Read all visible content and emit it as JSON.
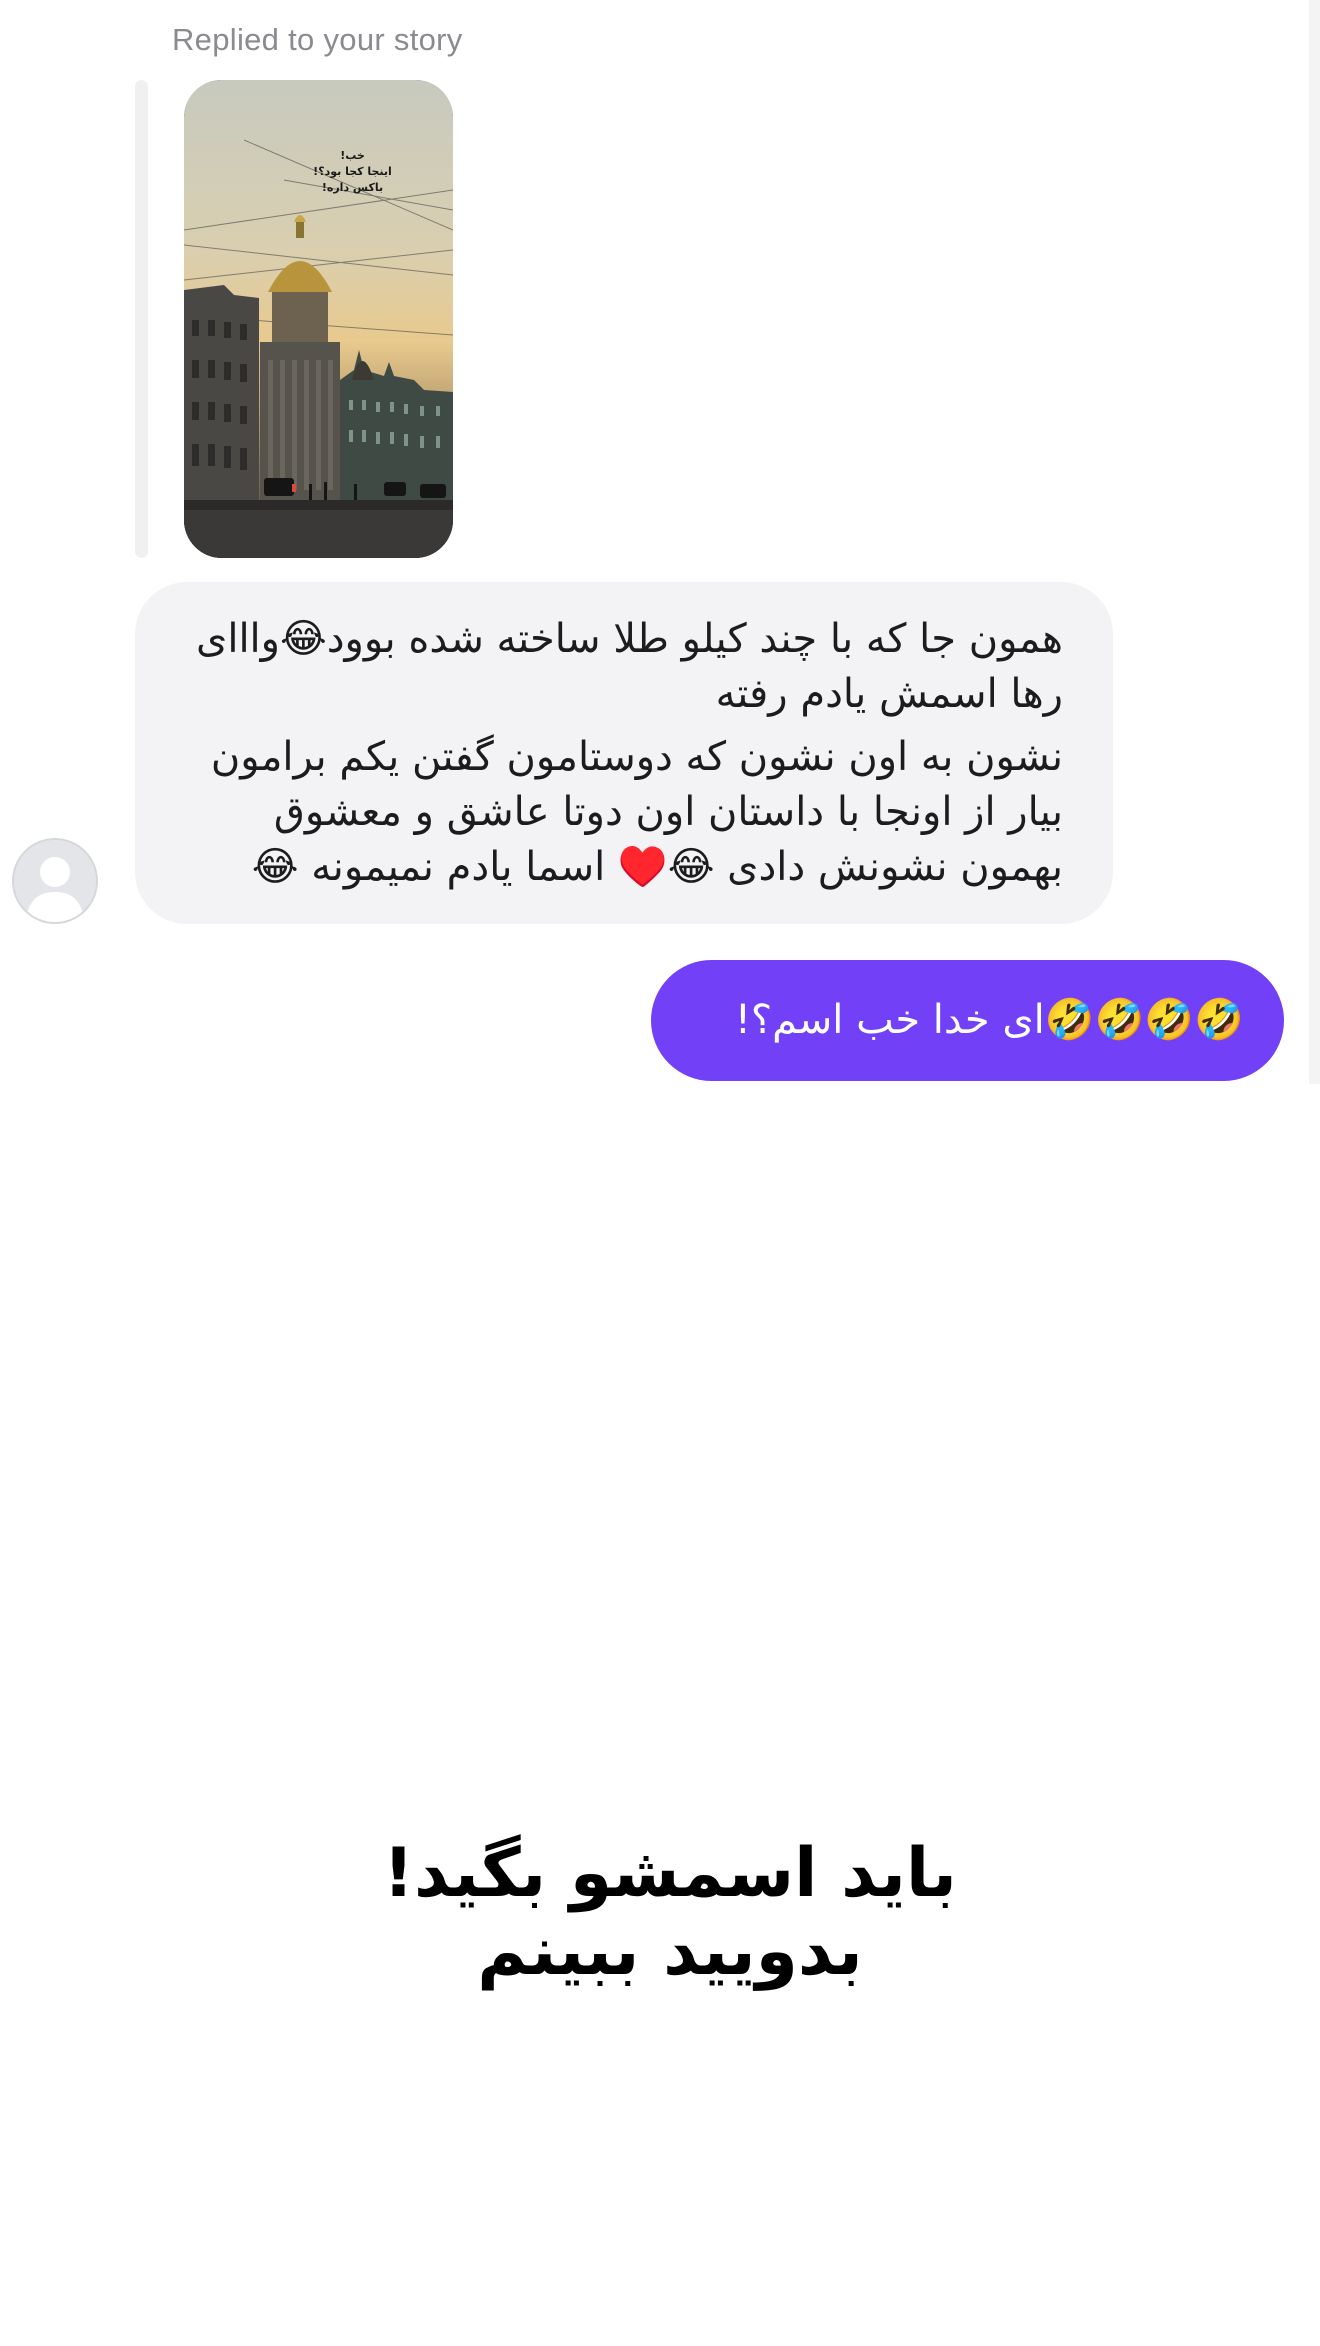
{
  "story_reply": {
    "label": "Replied to your story",
    "story_text": [
      "خب!",
      "اینجا کجا بود؟!",
      "باکس داره!"
    ]
  },
  "incoming_message": {
    "paragraphs": [
      "همون جا که با چند کیلو طلا ساخته شده بوود😂وااای رها اسمش یادم رفته",
      "نشون به اون نشون که دوستامون گفتن یکم برامون بیار از اونجا با داستان اون دوتا عاشق و معشوق بهمون نشونش دادی 😂♥️ اسما یادم نمیمونه 😂"
    ]
  },
  "outgoing_message": {
    "text": "🤣🤣🤣🤣ای خدا خب اسم؟!"
  },
  "overlay_caption": {
    "line1": "باید اسمشو بگید!",
    "line2": "بدویید ببینم"
  },
  "colors": {
    "incoming_bubble": "#f3f3f5",
    "outgoing_bubble": "#7140f7",
    "label_gray": "#8a8a8f"
  }
}
